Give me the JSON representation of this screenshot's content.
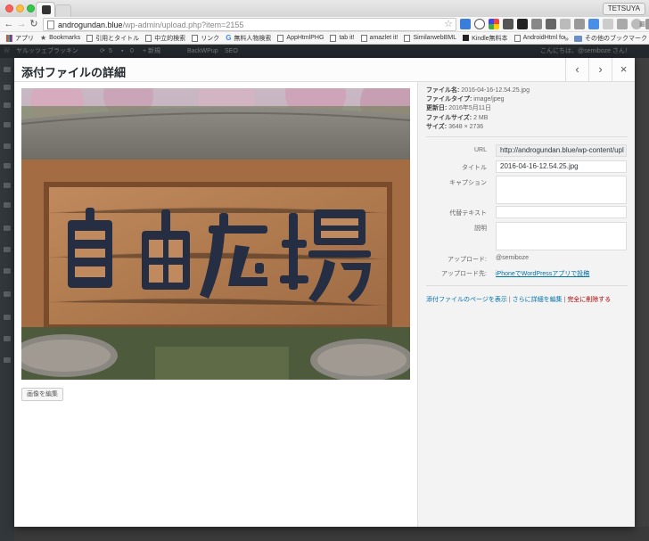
{
  "browser": {
    "profile_name": "TETSUYA",
    "url_domain": "androgundan.blue",
    "url_path": "/wp-admin/upload.php?item=2155",
    "bookmarks": [
      "アプリ",
      "Bookmarks",
      "引用とタイトル",
      "中立的検索",
      "リンク",
      "無料人物検索",
      "AppHtmlPHG",
      "tab it!",
      "amazlet it!",
      "SimilarwebBML",
      "Kindle無料本",
      "AndroidHtml for Play"
    ],
    "other_bookmarks": "その他のブックマーク",
    "more": "»"
  },
  "wp_admin_bar": {
    "site_name": "ヤルッツェブラッキン",
    "updates": "5",
    "comments": "0",
    "new": "+ 新規",
    "backwpup": "BackWPup",
    "seo": "SEO",
    "greeting": "こんにちは、@semiboze さん！"
  },
  "modal": {
    "title": "添付ファイルの詳細",
    "prev_icon": "‹",
    "next_icon": "›",
    "close_icon": "×",
    "edit_image_button": "画像を編集",
    "image_alt_text": "自由広場",
    "meta": {
      "filename_label": "ファイル名:",
      "filename": "2016-04-16-12.54.25.jpg",
      "filetype_label": "ファイルタイプ:",
      "filetype": "image/jpeg",
      "updated_label": "更新日:",
      "updated": "2016年5月11日",
      "filesize_label": "ファイルサイズ:",
      "filesize": "2 MB",
      "size_label": "サイズ:",
      "size": "3648 × 2736"
    },
    "fields": {
      "url_label": "URL",
      "url_value": "http://androgundan.blue/wp-content/upl",
      "title_label": "タイトル",
      "title_value": "2016-04-16-12.54.25.jpg",
      "caption_label": "キャプション",
      "caption_value": "",
      "alt_label": "代替テキスト",
      "alt_value": "",
      "description_label": "説明",
      "description_value": "",
      "uploaded_by_label": "アップロード:",
      "uploaded_by": "@semiboze",
      "uploaded_to_label": "アップロード先:",
      "uploaded_to": "iPhoneでWordPressアプリで投稿"
    },
    "actions": {
      "view_page": "添付ファイルのページを表示",
      "sep1": " | ",
      "edit_more": "さらに詳細を編集",
      "sep2": " | ",
      "delete": "完全に削除する"
    }
  }
}
